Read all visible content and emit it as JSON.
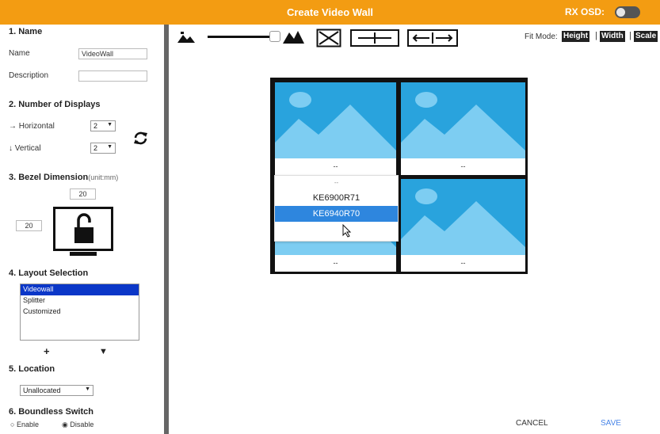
{
  "titlebar": {
    "title": "Create Video Wall",
    "osd_label": "RX OSD:",
    "osd_on": false
  },
  "name_section": {
    "heading": "1. Name",
    "name_label": "Name",
    "name_value": "VideoWall",
    "description_label": "Description",
    "description_value": ""
  },
  "displays_section": {
    "heading": "2. Number of Displays",
    "horizontal_label": "→ Horizontal",
    "horizontal_value": "2",
    "vertical_label": "↓ Vertical",
    "vertical_value": "2"
  },
  "bezel_section": {
    "heading": "3. Bezel Dimension",
    "unit": "(unit:mm)",
    "top_value": "20",
    "left_value": "20"
  },
  "layout_section": {
    "heading": "4. Layout Selection",
    "options": [
      "Videowall",
      "Splitter",
      "Customized"
    ],
    "selected": "Videowall",
    "add_label": "+",
    "down_label": "▼"
  },
  "location_section": {
    "heading": "5. Location",
    "value": "Unallocated"
  },
  "boundless_section": {
    "heading": "6. Boundless Switch",
    "enable_label": "Enable",
    "disable_label": "Disable",
    "selected": "Disable"
  },
  "toolbar": {
    "fit_mode_label": "Fit Mode:",
    "height_label": "Height",
    "width_label": "Width",
    "scale_label": "Scale"
  },
  "wall": {
    "cells": [
      {
        "label": "--"
      },
      {
        "label": "--"
      },
      {
        "label": "--"
      },
      {
        "label": "--"
      }
    ]
  },
  "dropdown": {
    "options": [
      "--",
      "KE6900R71",
      "KE6940R70"
    ],
    "highlighted": "KE6940R70"
  },
  "footer": {
    "cancel_label": "CANCEL",
    "save_label": "SAVE"
  },
  "colors": {
    "title_bar": "#f39c12",
    "image_blue": "#29a3dd",
    "highlight": "#2e86de",
    "listbox_selected": "#0b37c8"
  }
}
